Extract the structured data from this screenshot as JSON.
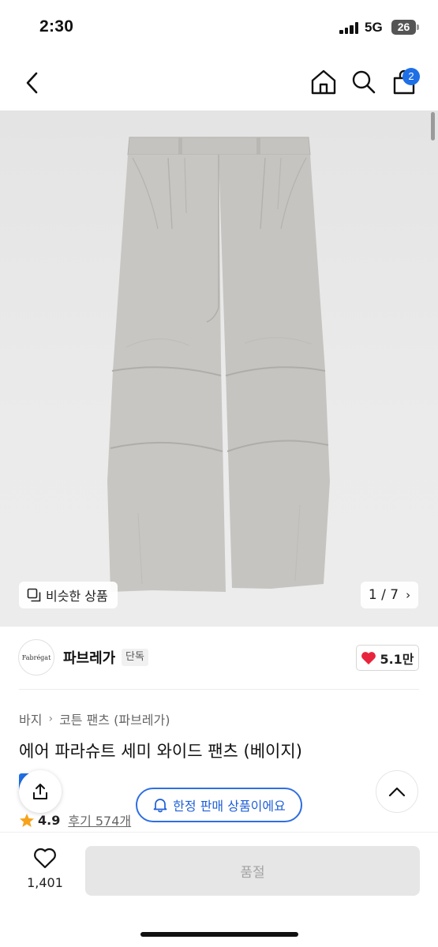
{
  "status_bar": {
    "time": "2:30",
    "network": "5G",
    "battery": "26"
  },
  "nav": {
    "cart_count": "2",
    "icons": [
      "back-arrow-icon",
      "home-icon",
      "search-icon",
      "cart-icon"
    ]
  },
  "gallery": {
    "similar_label": "비슷한 상품",
    "page_indicator": "1 / 7",
    "image_description_icon": "pants-image"
  },
  "brand": {
    "logo_text": "Fabrégat",
    "name": "파브레가",
    "tag": "단독",
    "likes": "5.1만"
  },
  "product": {
    "breadcrumb": [
      "바지",
      "코튼 팬츠 (파브레가)"
    ],
    "title": "에어 파라슈트 세미 와이드 팬츠 (베이지)",
    "rating": "4.9",
    "reviews": "후기 574개",
    "limited_notice": "한정 판매 상품이에요"
  },
  "bottom_bar": {
    "wish_count": "1,401",
    "buy_label": "품절"
  },
  "colors": {
    "accent_blue": "#1f6fe5",
    "heart_red": "#e8243c",
    "star_orange": "#f7a21b",
    "disabled_gray": "#e6e6e6"
  }
}
